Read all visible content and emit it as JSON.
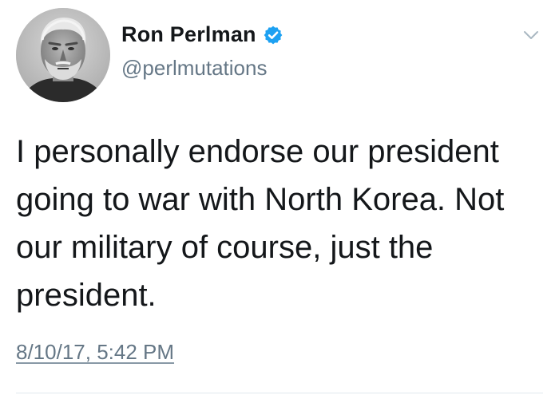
{
  "tweet": {
    "author": {
      "display_name": "Ron Perlman",
      "handle": "@perlmutations",
      "verified": true
    },
    "text": "I personally endorse our president going to war with North Korea. Not our military of course, just the president.",
    "timestamp": "8/10/17, 5:42 PM"
  },
  "icons": {
    "verified": "verified-badge-icon",
    "menu": "chevron-down-icon",
    "avatar": "profile-photo"
  },
  "colors": {
    "text": "#14171a",
    "secondary": "#657786",
    "verified": "#1da1f2",
    "background": "#ffffff"
  }
}
